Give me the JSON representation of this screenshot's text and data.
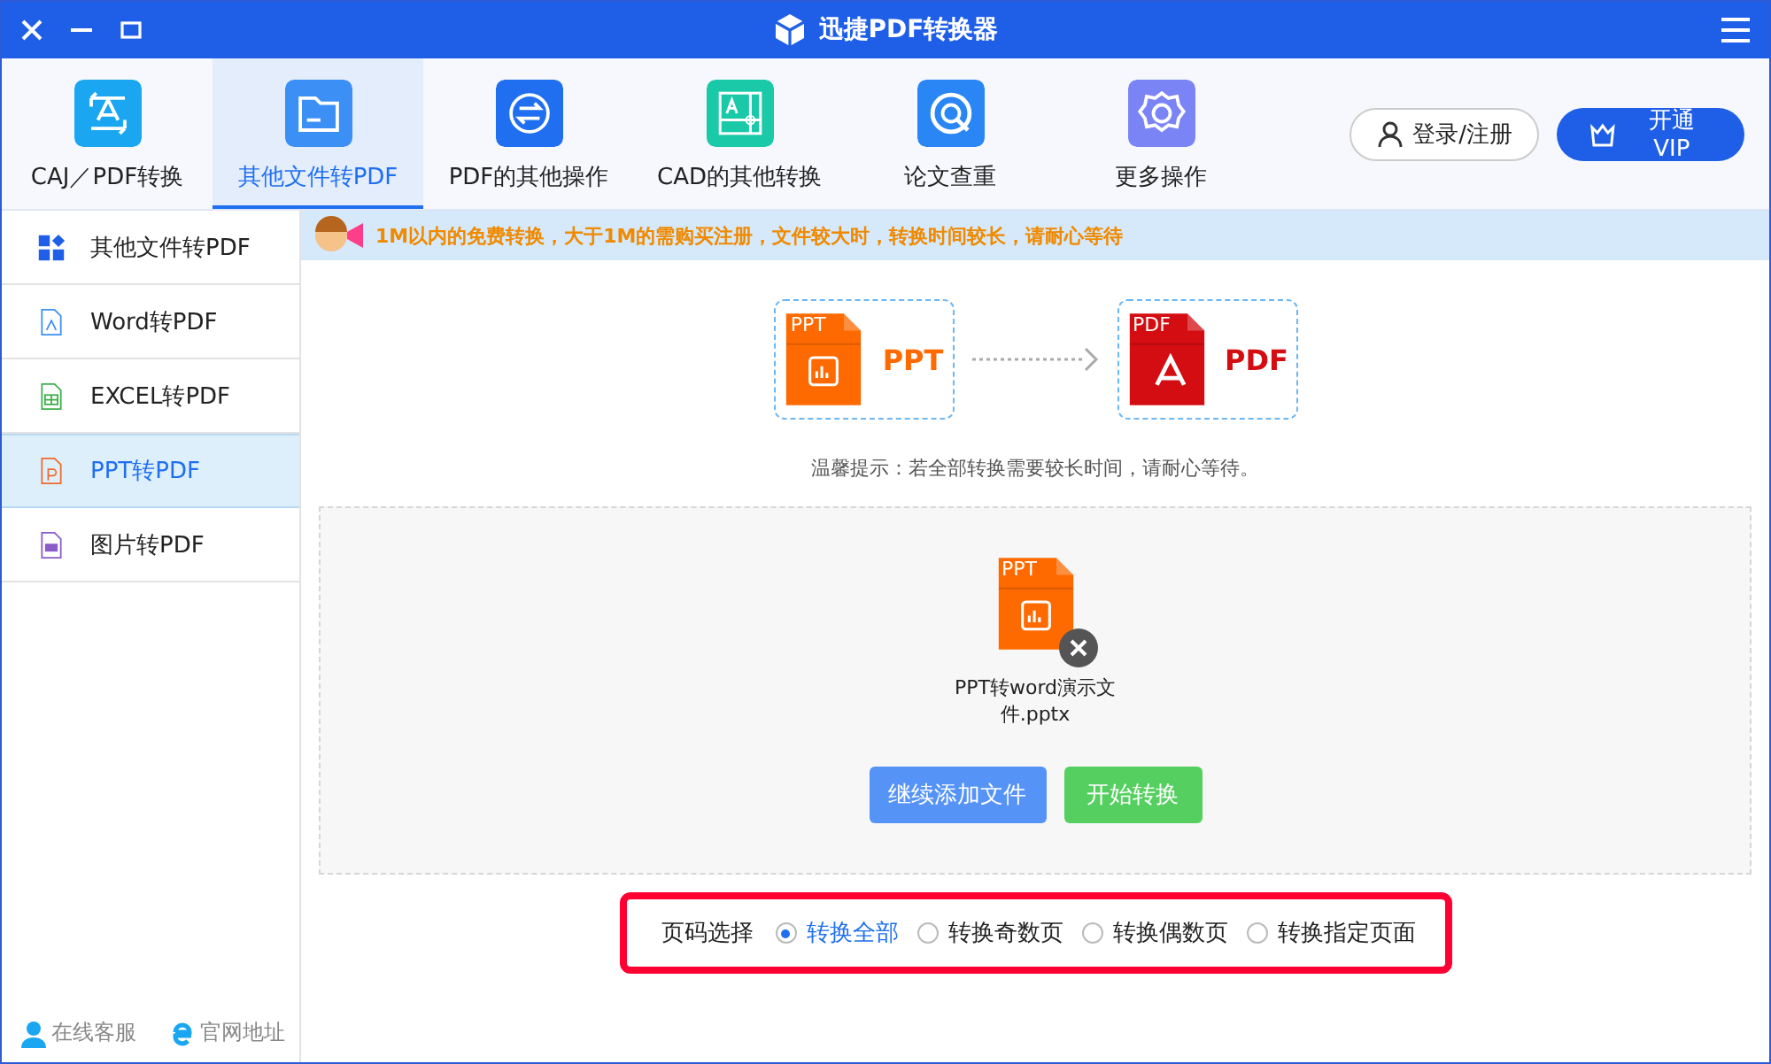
{
  "window": {
    "title": "迅捷PDF转换器"
  },
  "toolbar": {
    "tabs": [
      {
        "label": "CAJ／PDF转换",
        "kind": "caj",
        "selected": false
      },
      {
        "label": "其他文件转PDF",
        "kind": "folder",
        "selected": true
      },
      {
        "label": "PDF的其他操作",
        "kind": "swap",
        "selected": false
      },
      {
        "label": "CAD的其他转换",
        "kind": "cad",
        "selected": false
      },
      {
        "label": "论文查重",
        "kind": "check",
        "selected": false
      },
      {
        "label": "更多操作",
        "kind": "gear",
        "selected": false
      }
    ],
    "login_button": "登录/注册",
    "vip_button": "开通VIP"
  },
  "sidebar": {
    "items": [
      {
        "label": "其他文件转PDF",
        "kind": "grid",
        "selected": false
      },
      {
        "label": "Word转PDF",
        "kind": "word",
        "selected": false
      },
      {
        "label": "EXCEL转PDF",
        "kind": "excel",
        "selected": false
      },
      {
        "label": "PPT转PDF",
        "kind": "ppt",
        "selected": true
      },
      {
        "label": "图片转PDF",
        "kind": "jpg",
        "selected": false
      }
    ],
    "footer_links": [
      {
        "label": "在线客服",
        "kind": "service"
      },
      {
        "label": "官网地址",
        "kind": "web"
      }
    ]
  },
  "notice": "1M以内的免费转换，大于1M的需购买注册，文件较大时，转换时间较长，请耐心等待",
  "conversion": {
    "from": {
      "kind": "ppt",
      "badge": "PPT",
      "label": "PPT"
    },
    "to": {
      "kind": "pdf",
      "badge": "PDF",
      "label": "PDF"
    }
  },
  "tip": "温馨提示：若全部转换需要较长时间，请耐心等待。",
  "file": {
    "badge": "PPT",
    "name": "PPT转word演示文件.pptx"
  },
  "buttons": [
    {
      "label": "继续添加文件",
      "kind": "add"
    },
    {
      "label": "开始转换",
      "kind": "start"
    }
  ],
  "page_selection": {
    "label": "页码选择",
    "highlighted": true,
    "options": [
      {
        "label": "转换全部",
        "selected": true
      },
      {
        "label": "转换奇数页",
        "selected": false
      },
      {
        "label": "转换偶数页",
        "selected": false
      },
      {
        "label": "转换指定页面",
        "selected": false
      }
    ]
  }
}
